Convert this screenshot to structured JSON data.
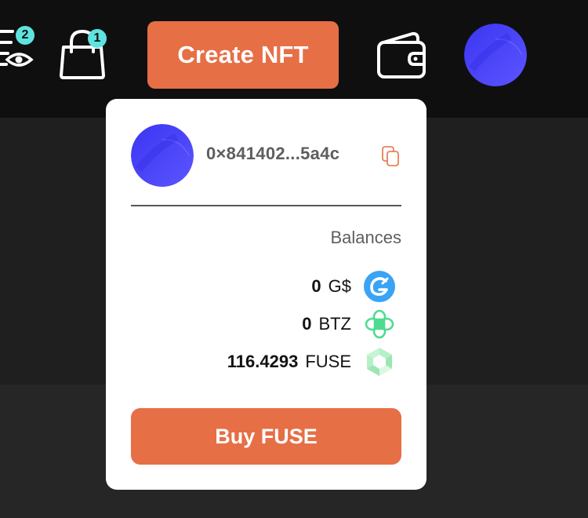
{
  "header": {
    "watchlist_badge": "2",
    "cart_badge": "1",
    "create_nft_label": "Create NFT"
  },
  "wallet_menu": {
    "address": "0×841402...5a4c",
    "balances_label": "Balances",
    "balances": [
      {
        "amount": "0",
        "symbol": "G$",
        "icon": "gooddollar-icon",
        "color": "#3aa3f5"
      },
      {
        "amount": "0",
        "symbol": "BTZ",
        "icon": "btz-icon",
        "color": "#4ddc8f"
      },
      {
        "amount": "116.4293",
        "symbol": "FUSE",
        "icon": "fuse-icon",
        "color": "#b6f0c8"
      }
    ],
    "buy_label": "Buy FUSE"
  },
  "colors": {
    "accent": "#e66f46",
    "badge": "#5ee3e0",
    "avatar_gradient_start": "#3b35f2",
    "avatar_gradient_end": "#5b55ff",
    "topbar_bg": "#0f0f10"
  }
}
